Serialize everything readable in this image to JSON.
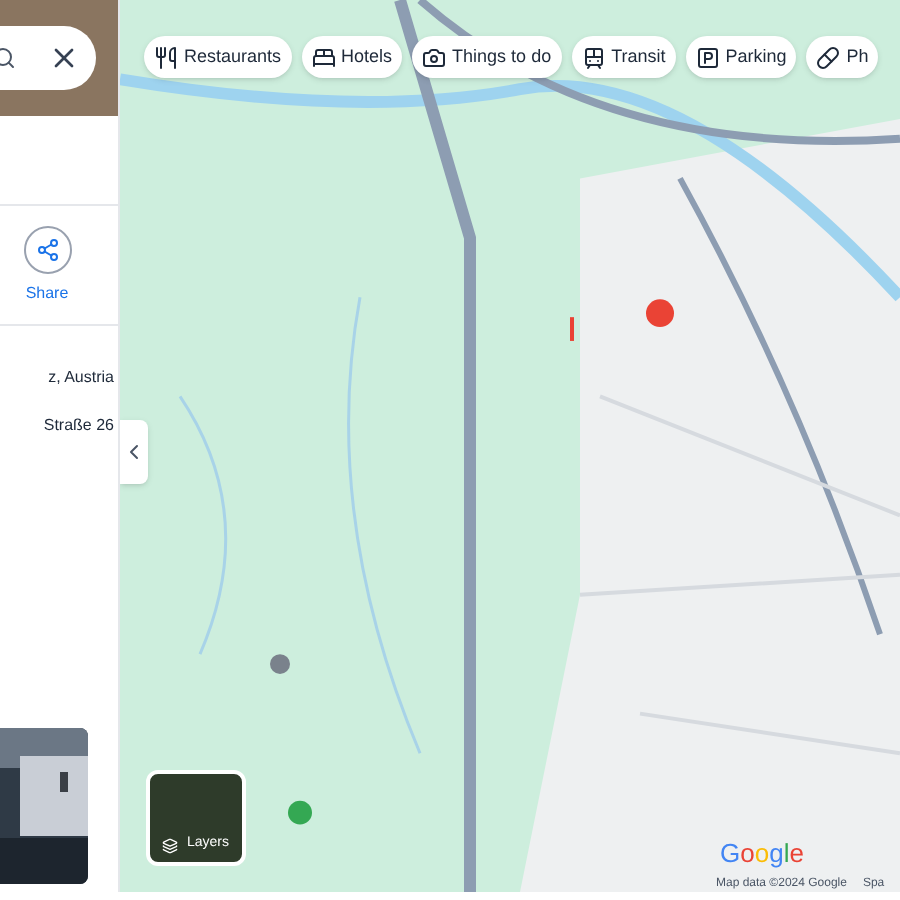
{
  "side_panel": {
    "share_label": "Share",
    "address_line": "z, Austria",
    "street_line": "Straße 26"
  },
  "chips": [
    {
      "kind": "restaurant",
      "label": "Restaurants"
    },
    {
      "kind": "hotel",
      "label": "Hotels"
    },
    {
      "kind": "camera",
      "label": "Things to do"
    },
    {
      "kind": "transit",
      "label": "Transit"
    },
    {
      "kind": "parking",
      "label": "Parking"
    },
    {
      "kind": "pharmacy",
      "label": "Ph"
    }
  ],
  "layers_button": {
    "label": "Layers"
  },
  "google_logo": "Google",
  "attribution": [
    "Map data ©2024 Google",
    "Spa"
  ]
}
